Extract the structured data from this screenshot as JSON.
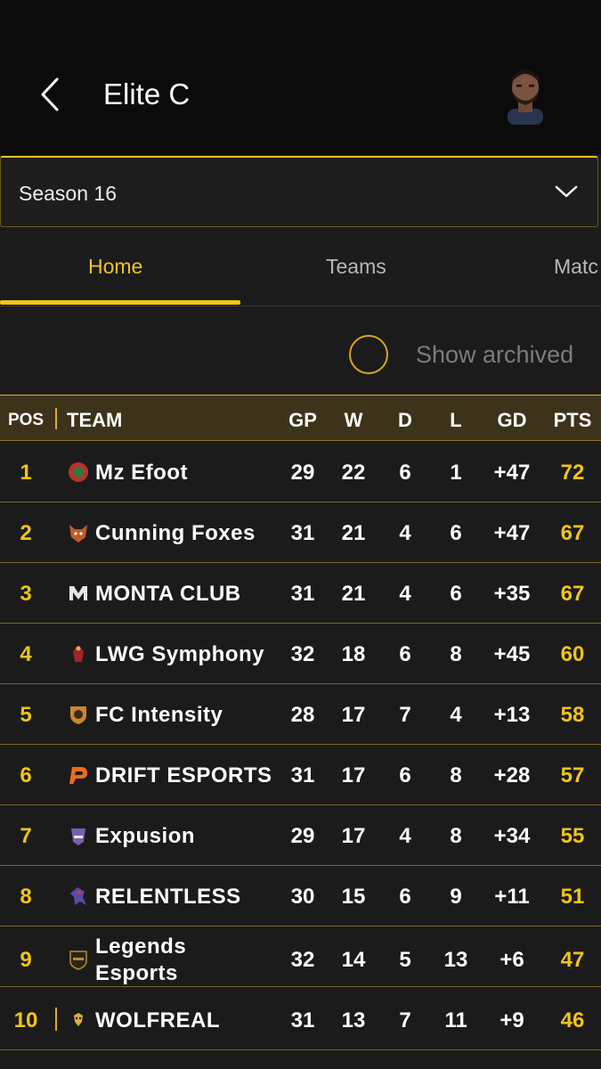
{
  "header": {
    "title": "Elite C"
  },
  "season_select": {
    "value": "Season 16"
  },
  "tabs": [
    {
      "label": "Home",
      "active": true
    },
    {
      "label": "Teams",
      "active": false
    },
    {
      "label": "Matc",
      "active": false
    }
  ],
  "archive": {
    "label": "Show archived",
    "checked": false
  },
  "columns": {
    "pos": "POS",
    "team": "TEAM",
    "gp": "GP",
    "w": "W",
    "d": "D",
    "l": "L",
    "gd": "GD",
    "pts": "PTS"
  },
  "standings": [
    {
      "pos": "1",
      "team": "Mz Efoot",
      "gp": "29",
      "w": "22",
      "d": "6",
      "l": "1",
      "gd": "+47",
      "pts": "72",
      "logo_color": "#b8322c"
    },
    {
      "pos": "2",
      "team": "Cunning Foxes",
      "gp": "31",
      "w": "21",
      "d": "4",
      "l": "6",
      "gd": "+47",
      "pts": "67",
      "logo_color": "#c25a2a"
    },
    {
      "pos": "3",
      "team": "MONTA CLUB",
      "gp": "31",
      "w": "21",
      "d": "4",
      "l": "6",
      "gd": "+35",
      "pts": "67",
      "logo_color": "#e6e6e6"
    },
    {
      "pos": "4",
      "team": "LWG Symphony",
      "gp": "32",
      "w": "18",
      "d": "6",
      "l": "8",
      "gd": "+45",
      "pts": "60",
      "logo_color": "#a3232a"
    },
    {
      "pos": "5",
      "team": "FC Intensity",
      "gp": "28",
      "w": "17",
      "d": "7",
      "l": "4",
      "gd": "+13",
      "pts": "58",
      "logo_color": "#c8862e"
    },
    {
      "pos": "6",
      "team": "DRIFT ESPORTS",
      "gp": "31",
      "w": "17",
      "d": "6",
      "l": "8",
      "gd": "+28",
      "pts": "57",
      "logo_color": "#ef6a1d"
    },
    {
      "pos": "7",
      "team": "Expusion",
      "gp": "29",
      "w": "17",
      "d": "4",
      "l": "8",
      "gd": "+34",
      "pts": "55",
      "logo_color": "#7b5fb0"
    },
    {
      "pos": "8",
      "team": "RELENTLESS",
      "gp": "30",
      "w": "15",
      "d": "6",
      "l": "9",
      "gd": "+11",
      "pts": "51",
      "logo_color": "#5b4aa8"
    },
    {
      "pos": "9",
      "team_line1": "Legends",
      "team_line2": "Esports",
      "gp": "32",
      "w": "14",
      "d": "5",
      "l": "13",
      "gd": "+6",
      "pts": "47",
      "logo_color": "#b8902a"
    },
    {
      "pos": "10",
      "team": "WOLFREAL",
      "gp": "31",
      "w": "13",
      "d": "7",
      "l": "11",
      "gd": "+9",
      "pts": "46",
      "logo_color": "#d8b040"
    }
  ]
}
